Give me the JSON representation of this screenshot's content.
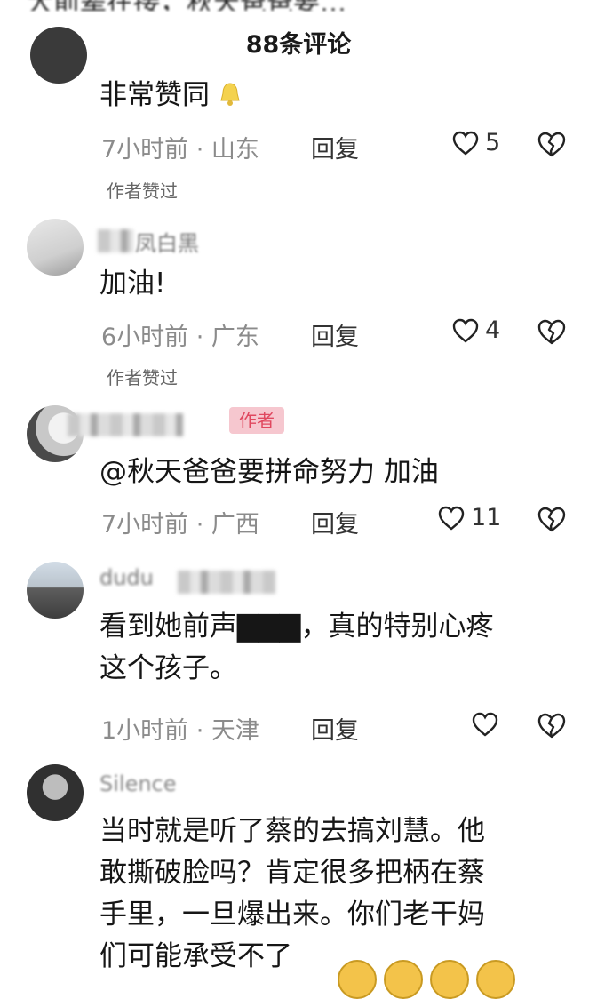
{
  "top_cut_text": "大前辈在接，秋天爸爸要…",
  "header": {
    "title": "88条评论"
  },
  "comments": [
    {
      "content": "非常赞同",
      "time_location": "7小时前 · 山东",
      "reply_label": "回复",
      "likes": "5",
      "author_liked": "作者赞过"
    },
    {
      "name": "凤白黑",
      "content": "加油!",
      "time_location": "6小时前 · 广东",
      "reply_label": "回复",
      "likes": "4",
      "author_liked": "作者赞过"
    },
    {
      "badge": "作者",
      "content": "@秋天爸爸要拼命努力 加油",
      "time_location": "7小时前 · 广西",
      "reply_label": "回复",
      "likes": "11"
    },
    {
      "name": "dudu",
      "content_lines": [
        "看到她前声▇▇▇，真的特别心疼",
        "这个孩子。"
      ],
      "time_location": "1小时前 · 天津",
      "reply_label": "回复"
    },
    {
      "name": "Silence",
      "content_lines": [
        "当时就是听了蔡的去搞刘慧。他",
        "敢撕破脸吗？肯定很多把柄在蔡",
        "手里，一旦爆出来。你们老干妈",
        "们可能承受不了"
      ]
    }
  ]
}
